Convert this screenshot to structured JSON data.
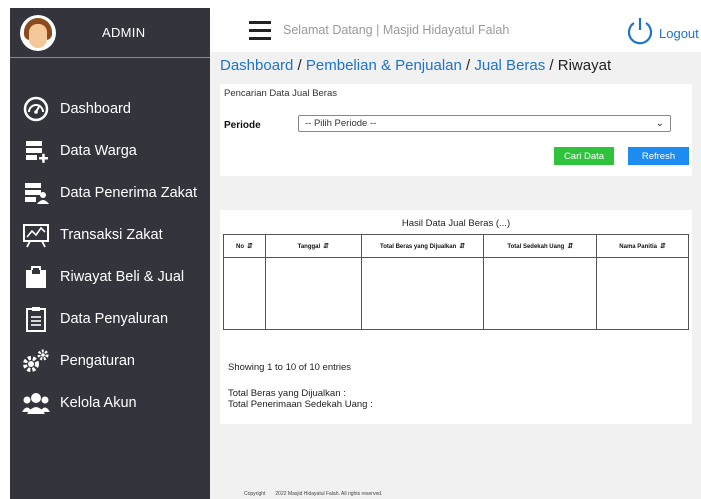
{
  "sidebar": {
    "admin": "ADMIN",
    "items": [
      {
        "label": "Dashboard",
        "icon": "dashboard-icon"
      },
      {
        "label": "Data Warga",
        "icon": "add-data-icon"
      },
      {
        "label": "Data Penerima Zakat",
        "icon": "user-data-icon"
      },
      {
        "label": "Transaksi Zakat",
        "icon": "chart-board-icon"
      },
      {
        "label": "Riwayat Beli & Jual",
        "icon": "shopping-bag-icon"
      },
      {
        "label": "Data Penyaluran",
        "icon": "clipboard-icon"
      },
      {
        "label": "Pengaturan",
        "icon": "gears-icon"
      },
      {
        "label": "Kelola Akun",
        "icon": "users-icon"
      }
    ]
  },
  "header": {
    "welcome": "Selamat Datang | Masjid Hidayatul Falah",
    "logout": "Logout"
  },
  "breadcrumb": {
    "dashboard": "Dashboard",
    "sep": " / ",
    "pembelian": "Pembelian & Penjualan",
    "jual": "Jual Beras",
    "current": "Riwayat"
  },
  "search": {
    "title": "Pencarian Data Jual Beras",
    "periode_label": "Periode",
    "periode_value": "-- Pilih Periode --",
    "cari_label": "Cari Data",
    "refresh_label": "Refresh"
  },
  "results": {
    "title": "Hasil Data Jual Beras (...)",
    "columns": [
      "No",
      "Tanggal",
      "Total Beras yang Dijualkan",
      "Total Sedekah Uang",
      "Nama Panitia"
    ],
    "showing": "Showing 1 to 10 of 10 entries",
    "total_beras": "Total Beras yang Dijualkan  :",
    "total_sedekah": "Total Penerimaan Sedekah Uang :"
  },
  "footer": {
    "copyright": "Copyright",
    "text": "2022 Masjid Hidayatul Falah. All rights reserved."
  },
  "colors": {
    "sidebar": "#33343c",
    "link": "#1e73c8",
    "cari": "#2fc33c",
    "refresh": "#1d8cf0"
  }
}
